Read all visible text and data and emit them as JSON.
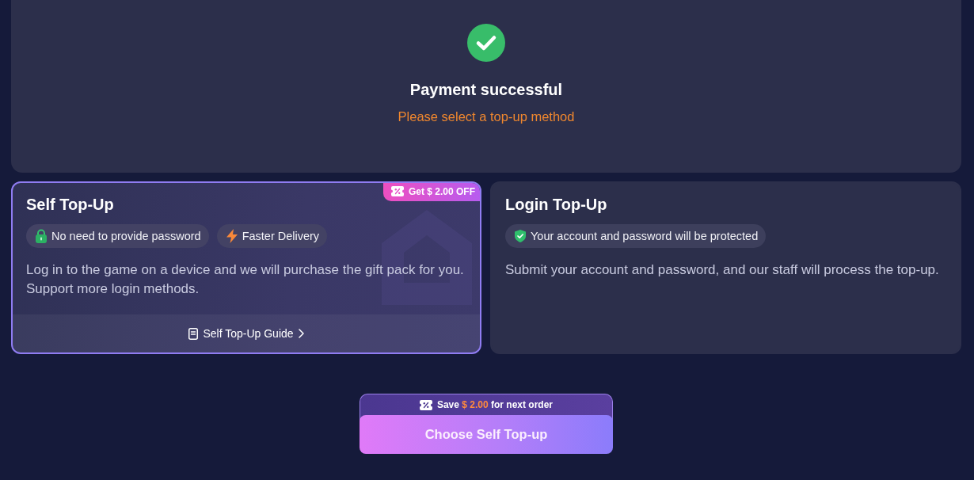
{
  "status": {
    "kind": "success",
    "title": "Payment successful",
    "subtitle": "Please select a top-up method"
  },
  "methods": [
    {
      "title": "Self Top-Up",
      "selected": true,
      "badge": "Get $ 2.00 OFF",
      "features": [
        {
          "kind": "lock",
          "label": "No need to provide password"
        },
        {
          "kind": "bolt",
          "label": "Faster Delivery"
        }
      ],
      "description": "Log in to the game on a device and we will purchase the gift pack for you. Support more login methods.",
      "guide": "Self Top-Up Guide"
    },
    {
      "title": "Login Top-Up",
      "selected": false,
      "features": [
        {
          "kind": "shield",
          "label": "Your account and password will be protected"
        }
      ],
      "description": "Submit your account and password, and our staff will process the top-up."
    }
  ],
  "promo": {
    "before": "Save",
    "amount": "$ 2.00",
    "after": "for next order"
  },
  "button": {
    "label": "Choose Self Top-up"
  }
}
